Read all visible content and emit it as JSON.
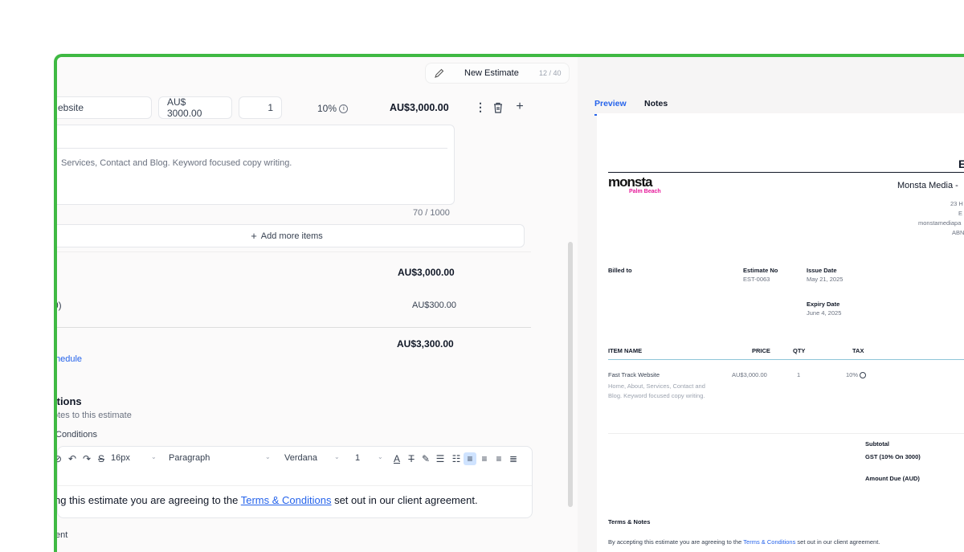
{
  "title_bar": {
    "title": "New Estimate",
    "counter": "12 / 40"
  },
  "line_item": {
    "name": "ebsite",
    "price": "AU$  3000.00",
    "qty": "1",
    "tax": "10%",
    "amount": "AU$3,000.00",
    "description": "Services, Contact and Blog. Keyword focused copy writing.",
    "char_count": "70 / 1000"
  },
  "add_more_label": "Add more items",
  "totals": {
    "subtotal": "AU$3,000.00",
    "tax_label": "0)",
    "tax": "AU$300.00",
    "total": "AU$3,300.00"
  },
  "schedule_link": "hedule",
  "notes_section": {
    "heading": "itions",
    "sub": "otes to this estimate",
    "field_label": "Conditions"
  },
  "toolbar": {
    "font_size": "16px",
    "block": "Paragraph",
    "font": "Verdana",
    "line_height": "1"
  },
  "editor": {
    "before": "ng this estimate you are agreeing to the ",
    "link": "Terms & Conditions",
    "after": " set out in our client agreement."
  },
  "bottom_label": "ent",
  "tabs": {
    "preview": "Preview",
    "notes": "Notes"
  },
  "preview_doc": {
    "doc_title": "E",
    "logo_main": "monsta",
    "logo_sub": "Palm Beach",
    "company": "Monsta Media -",
    "addr1": "23 H",
    "addr2": "E",
    "email": "monstamediapa",
    "abn": "ABN",
    "billed_to": "Billed to",
    "estimate_no_label": "Estimate No",
    "estimate_no": "EST-0063",
    "issue_date_label": "Issue Date",
    "issue_date": "May 21, 2025",
    "expiry_label": "Expiry Date",
    "expiry": "June 4, 2025",
    "col_item": "ITEM NAME",
    "col_price": "PRICE",
    "col_qty": "QTY",
    "col_tax": "TAX",
    "item_name": "Fast Track Website",
    "item_desc": "Home, About, Services, Contact and Blog. Keyword focused copy writing.",
    "item_price": "AU$3,000.00",
    "item_qty": "1",
    "item_tax": "10%",
    "subtotal_label": "Subtotal",
    "gst_label": "GST (10% On 3000)",
    "amount_due_label": "Amount Due (AUD)",
    "terms_heading": "Terms & Notes",
    "terms_before": "By accepting this estimate you are agreeing to the ",
    "terms_link": "Terms & Conditions",
    "terms_after": " set out in our client agreement."
  },
  "colors": {
    "accent": "#2563eb",
    "frame": "#3fb943",
    "logo_pink": "#e6199a"
  }
}
